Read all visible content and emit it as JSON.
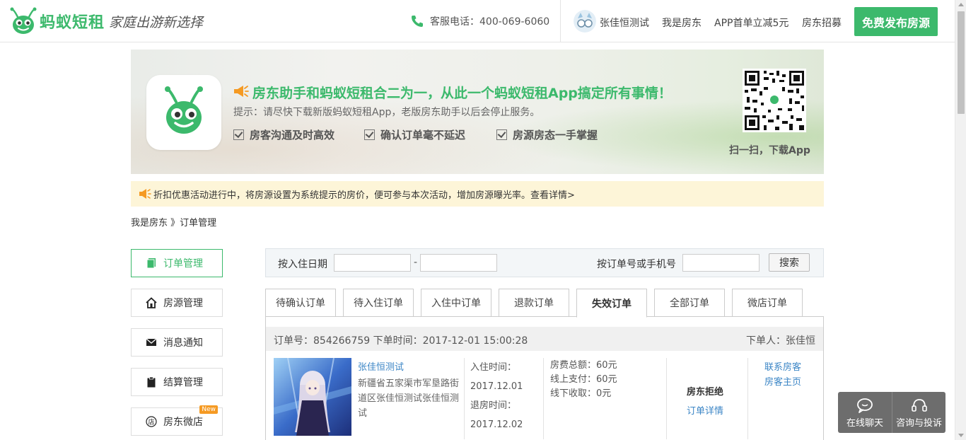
{
  "header": {
    "brand": "蚂蚁短租",
    "slogan": "家庭出游新选择",
    "hotline": "客服电话：400-069-6060",
    "user_name": "张佳恒测试",
    "links": [
      "我是房东",
      "APP首单立减5元",
      "房东招募"
    ],
    "publish_label": "免费发布房源"
  },
  "banner": {
    "title": "房东助手和蚂蚁短租合二为一，从此一个蚂蚁短租App搞定所有事情！",
    "tip": "提示：请尽快下载新版蚂蚁短租App，老版房东助手以后会停止服务。",
    "features": [
      "房客沟通及时高效",
      "确认订单毫不延迟",
      "房源房态一手掌握"
    ],
    "qr_caption": "扫一扫，下载App"
  },
  "notice": {
    "text": "折扣优惠活动进行中，将房源设置为系统提示的房价，便可参与本次活动，增加房源曝光率。查看详情>"
  },
  "breadcrumb": "我是房东 》订单管理",
  "sidebar": {
    "items": [
      {
        "label": "订单管理",
        "icon": "document-icon",
        "active": true
      },
      {
        "label": "房源管理",
        "icon": "house-icon",
        "active": false
      },
      {
        "label": "消息通知",
        "icon": "envelope-icon",
        "active": false
      },
      {
        "label": "结算管理",
        "icon": "clipboard-icon",
        "active": false
      },
      {
        "label": "房东微店",
        "icon": "shop-icon",
        "active": false,
        "badge": "New"
      }
    ]
  },
  "search": {
    "date_label": "按入住日期",
    "date_from": "",
    "date_dash": "-",
    "date_to": "",
    "order_label": "按订单号或手机号",
    "order_value": "",
    "button": "搜索"
  },
  "tabs": [
    {
      "label": "待确认订单",
      "active": false
    },
    {
      "label": "待入住订单",
      "active": false
    },
    {
      "label": "入住中订单",
      "active": false
    },
    {
      "label": "退款订单",
      "active": false
    },
    {
      "label": "失效订单",
      "active": true
    },
    {
      "label": "全部订单",
      "active": false
    },
    {
      "label": "微店订单",
      "active": false
    }
  ],
  "order": {
    "head_left": "订单号：854266759 下单时间：2017-12-01 15:00:28",
    "head_right": "下单人：张佳恒",
    "house_name": "张佳恒测试",
    "address": "新疆省五家渠市军垦路街道区张佳恒测试张佳恒测试",
    "checkin_label": "入住时间：",
    "checkin_date": "2017.12.01",
    "checkout_label": "退房时间：",
    "checkout_date": "2017.12.02",
    "fee_total": "房费总额：60元",
    "fee_online": "线上支付：60元",
    "fee_offline": "线下收取：0元",
    "status": "房东拒绝",
    "detail_link": "订单详情",
    "contact_link": "联系房客",
    "guest_page_link": "房客主页"
  },
  "float": {
    "chat": "在线聊天",
    "complain": "咨询与投诉"
  },
  "colors": {
    "brand_green": "#3cb96c",
    "link_blue": "#3c86c6",
    "notice_bg": "#fdf5d8",
    "badge_orange": "#f59a23"
  }
}
